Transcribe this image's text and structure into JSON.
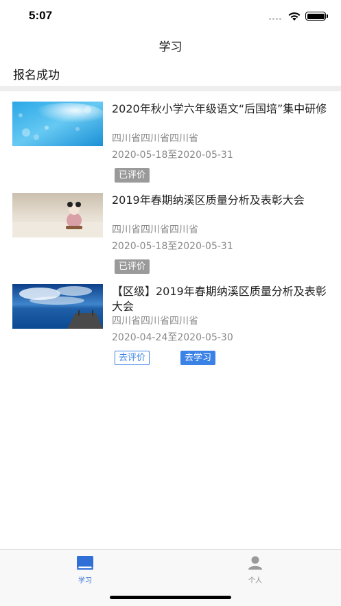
{
  "status": {
    "time": "5:07"
  },
  "nav": {
    "title": "学习"
  },
  "section": {
    "title": "报名成功"
  },
  "courses": [
    {
      "title": "2020年秋小学六年级语文“后国培”集中研修",
      "region": "四川省四川省四川省",
      "date_range": "2020-05-18至2020-05-31",
      "tags": [
        "已评价"
      ],
      "thumb": "blue-bokeh"
    },
    {
      "title": "2019年春期纳溪区质量分析及表彰大会",
      "region": "四川省四川省四川省",
      "date_range": "2020-05-18至2020-05-31",
      "tags": [
        "已评价"
      ],
      "thumb": "doll-on-table"
    },
    {
      "title": "【区级】2019年春期纳溪区质量分析及表彰大会",
      "region": "四川省四川省四川省",
      "date_range": "2020-04-24至2020-05-30",
      "tags": [
        "去评价",
        "去学习"
      ],
      "thumb": "sea-pier"
    }
  ],
  "tabbar": {
    "items": [
      {
        "label": "学习",
        "icon": "book-icon",
        "active": true
      },
      {
        "label": "个人",
        "icon": "person-icon",
        "active": false
      }
    ]
  },
  "colors": {
    "accent": "#3b82e6",
    "tag_done": "#9a9a9a",
    "divider": "#eeeeee"
  }
}
